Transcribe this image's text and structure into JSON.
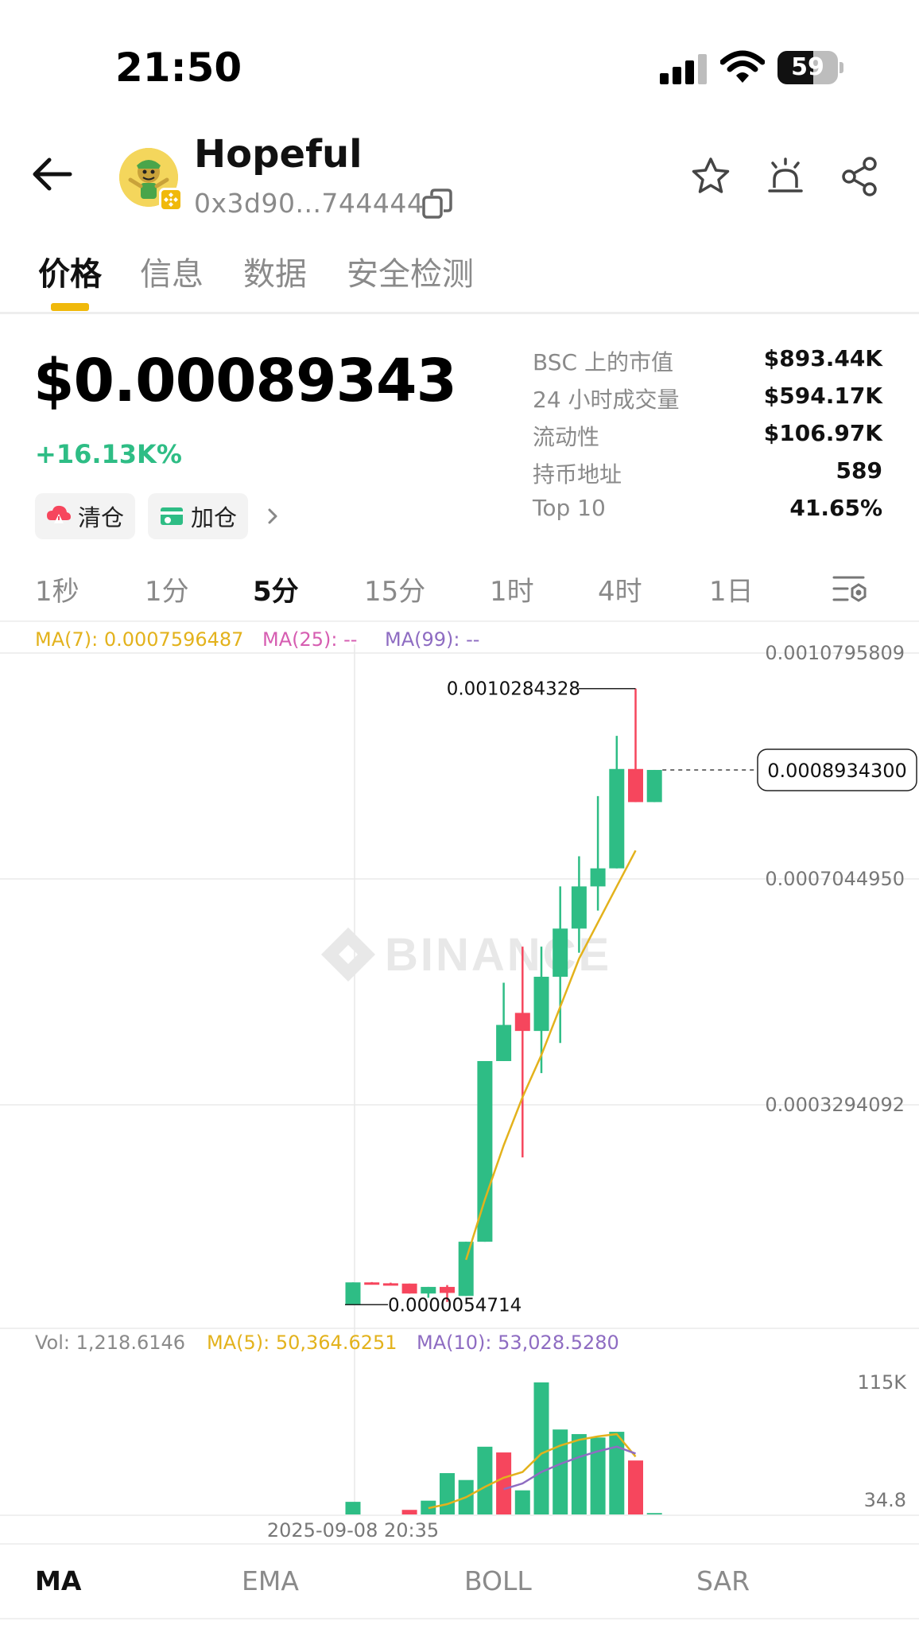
{
  "status_bar": {
    "time": "21:50",
    "battery": "59",
    "battery_level": 0.59
  },
  "header": {
    "token_name": "Hopeful",
    "token_address": "0x3d90...744444",
    "icons": [
      "back-arrow-icon",
      "copy-icon",
      "star-icon",
      "alert-bell-icon",
      "share-icon"
    ]
  },
  "tabs": [
    "价格",
    "信息",
    "数据",
    "安全检测"
  ],
  "price": {
    "value": "$0.00089343",
    "change": "+16.13K%",
    "chips": [
      "清仓",
      "加仓"
    ]
  },
  "stats": [
    {
      "label": "BSC 上的市值",
      "value": "$893.44K"
    },
    {
      "label": "24 小时成交量",
      "value": "$594.17K"
    },
    {
      "label": "流动性",
      "value": "$106.97K"
    },
    {
      "label": "持币地址",
      "value": "589"
    },
    {
      "label": "Top 10",
      "value": "41.65%"
    }
  ],
  "intervals": [
    "1秒",
    "1分",
    "5分",
    "15分",
    "1时",
    "4时",
    "1日"
  ],
  "active_interval": "5分",
  "ma_legend": [
    {
      "text": "MA(7): 0.0007596487",
      "color": "#e3b21c"
    },
    {
      "text": "MA(25): --",
      "color": "#d65db1"
    },
    {
      "text": "MA(99): --",
      "color": "#8e6cc2"
    }
  ],
  "vol_legend": [
    {
      "text": "Vol: 1,218.6146",
      "color": "#8a8a8a"
    },
    {
      "text": "MA(5): 50,364.6251",
      "color": "#e3b21c"
    },
    {
      "text": "MA(10): 53,028.5280",
      "color": "#8e6cc2"
    }
  ],
  "indicator_tabs": [
    "MA",
    "EMA",
    "BOLL",
    "SAR"
  ],
  "colors": {
    "up": "#2ebd85",
    "down": "#f6465d",
    "accent": "#f0b90b",
    "ma7": "#e3b21c",
    "ma10": "#8e6cc2"
  },
  "chart_data": {
    "type": "candlestick",
    "price_ticks": [
      "0.0010795809",
      "0.0007044950",
      "0.0003294092"
    ],
    "price_tick_values": [
      0.0010795809,
      0.000704495,
      0.0003294092
    ],
    "high_label": "0.0010284328",
    "high_value": 0.0010284328,
    "low_label": "0.0000054714",
    "low_value": 5.4714e-06,
    "current_label": "0.0008934300",
    "current_value": 0.00089343,
    "watermark": "BINANCE",
    "x_label": "2025-09-08 20:35",
    "candles": [
      {
        "o": 5.4e-06,
        "c": 4.25e-05,
        "h": 4.25e-05,
        "l": 5.4e-06
      },
      {
        "o": 4.25e-05,
        "c": 4.15e-05,
        "h": 4.3e-05,
        "l": 4.05e-05
      },
      {
        "o": 4.1e-05,
        "c": 4e-05,
        "h": 4.2e-05,
        "l": 3.95e-05
      },
      {
        "o": 4.05e-05,
        "c": 2.4e-05,
        "h": 4.05e-05,
        "l": 2.4e-05
      },
      {
        "o": 2.4e-05,
        "c": 3.5e-05,
        "h": 3.5e-05,
        "l": 1.7e-05
      },
      {
        "o": 3.5e-05,
        "c": 2.5e-05,
        "h": 3.8e-05,
        "l": 1e-05
      },
      {
        "o": 2e-05,
        "c": 0.00011,
        "h": 0.00011,
        "l": 2e-05
      },
      {
        "o": 0.00011,
        "c": 0.00041,
        "h": 0.00041,
        "l": 0.00011
      },
      {
        "o": 0.00041,
        "c": 0.00047,
        "h": 0.00054,
        "l": 0.00041
      },
      {
        "o": 0.00049,
        "c": 0.00046,
        "h": 0.0006,
        "l": 0.00025
      },
      {
        "o": 0.00046,
        "c": 0.00055,
        "h": 0.0006,
        "l": 0.00039
      },
      {
        "o": 0.00055,
        "c": 0.00063,
        "h": 0.0007,
        "l": 0.00044
      },
      {
        "o": 0.00063,
        "c": 0.0007,
        "h": 0.00075,
        "l": 0.00059
      },
      {
        "o": 0.0007,
        "c": 0.00073,
        "h": 0.00085,
        "l": 0.00066
      },
      {
        "o": 0.00073,
        "c": 0.000895,
        "h": 0.00095,
        "l": 0.00073
      },
      {
        "o": 0.000895,
        "c": 0.00084,
        "h": 0.0010284,
        "l": 0.00084
      },
      {
        "o": 0.00084,
        "c": 0.0008934,
        "h": 0.0008934,
        "l": 0.00084
      }
    ],
    "ma7": [
      null,
      null,
      null,
      null,
      null,
      null,
      8e-05,
      0.00018,
      0.00027,
      0.00035,
      0.00042,
      0.0005,
      0.00058,
      0.00064,
      0.0007,
      0.0007596
    ],
    "volume_ticks": [
      "115K",
      "34.8"
    ],
    "volume_tick_values": [
      115000,
      34.8
    ],
    "volumes": [
      11000,
      0,
      0,
      4000,
      12000,
      36000,
      30000,
      59000,
      54000,
      21000,
      115000,
      74000,
      70000,
      67000,
      72000,
      47000,
      1218.6146
    ],
    "volumes_up": [
      true,
      false,
      false,
      false,
      true,
      true,
      true,
      true,
      false,
      true,
      true,
      true,
      true,
      true,
      true,
      false,
      true
    ],
    "vol_ma5": [
      null,
      null,
      null,
      null,
      5500,
      9000,
      15000,
      24000,
      32000,
      37000,
      53000,
      60000,
      65000,
      68000,
      70000,
      50364.6251
    ],
    "vol_ma10": [
      null,
      null,
      null,
      null,
      null,
      null,
      null,
      null,
      22000,
      27000,
      37000,
      44000,
      50000,
      55000,
      59000,
      53028.528
    ]
  }
}
